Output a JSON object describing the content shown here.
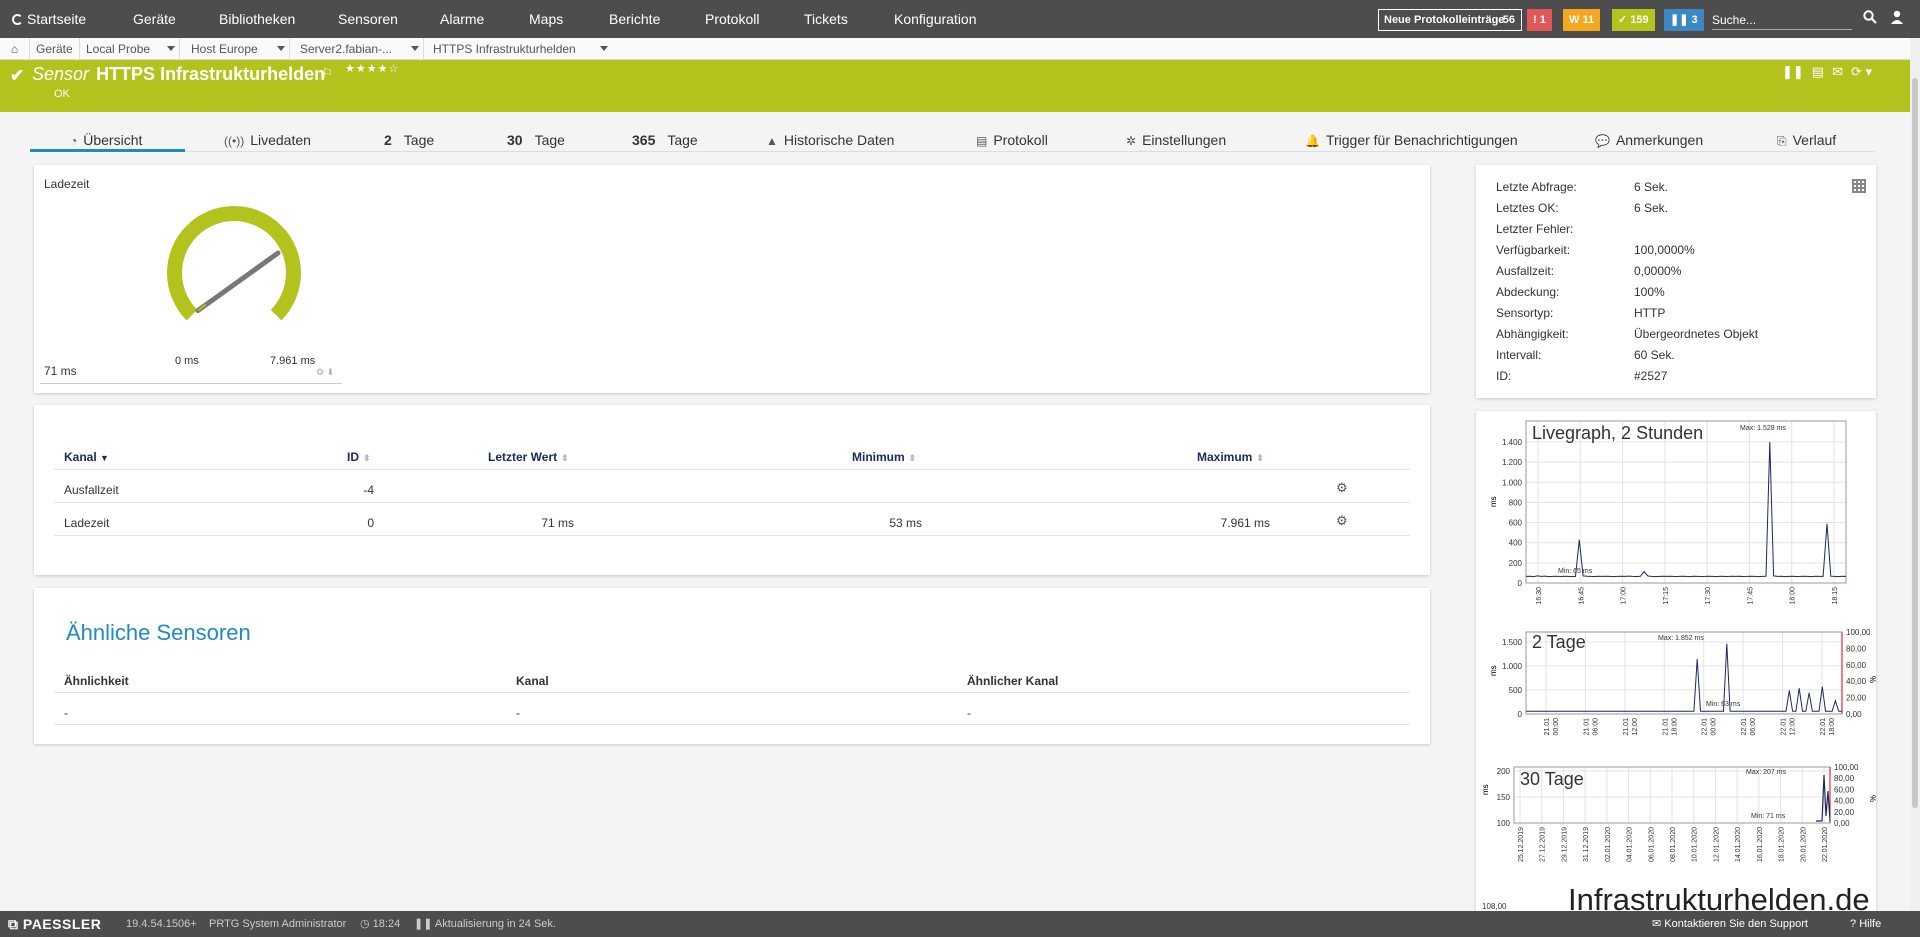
{
  "nav": {
    "home": "Startseite",
    "items": [
      "Geräte",
      "Bibliotheken",
      "Sensoren",
      "Alarme",
      "Maps",
      "Berichte",
      "Protokoll",
      "Tickets",
      "Konfiguration"
    ],
    "log_label": "Neue Protokolleinträge",
    "log_count": "56",
    "badge_red": "1",
    "badge_yellow": "11",
    "badge_green": "159",
    "badge_blue": "3",
    "search_placeholder": "Suche..."
  },
  "breadcrumb": [
    "Geräte",
    "Local Probe",
    "Host Europe",
    "Server2.fabian-...",
    "HTTPS Infrastrukturhelden"
  ],
  "sensor": {
    "prefix": "Sensor",
    "name": "HTTPS Infrastrukturhelden",
    "status": "OK",
    "stars": "★★★★☆"
  },
  "tabs": [
    {
      "icon": "◔",
      "label": "Übersicht"
    },
    {
      "icon": "((•))",
      "label": "Livedaten"
    },
    {
      "num": "2",
      "label": "Tage"
    },
    {
      "num": "30",
      "label": "Tage"
    },
    {
      "num": "365",
      "label": "Tage"
    },
    {
      "icon": "▲",
      "label": "Historische Daten"
    },
    {
      "icon": "▤",
      "label": "Protokoll"
    },
    {
      "icon": "✲",
      "label": "Einstellungen"
    },
    {
      "icon": "🔔",
      "label": "Trigger für Benachrichtigungen"
    },
    {
      "icon": "💬",
      "label": "Anmerkungen"
    },
    {
      "icon": "⎘",
      "label": "Verlauf"
    }
  ],
  "gauge": {
    "title": "Ladezeit",
    "min": "0 ms",
    "max": "7.961 ms",
    "value": "71 ms",
    "value_ratio": 0.009
  },
  "info": [
    {
      "k": "Letzte Abfrage:",
      "v": "6 Sek.",
      "bold": true
    },
    {
      "k": "Letztes OK:",
      "v": "6 Sek.",
      "bold": true
    },
    {
      "k": "Letzter Fehler:",
      "v": "",
      "bold": false
    },
    {
      "k": "Verfügbarkeit:",
      "v": "100,0000%",
      "bold": false
    },
    {
      "k": "Ausfallzeit:",
      "v": "0,0000%",
      "bold": false
    },
    {
      "k": "Abdeckung:",
      "v": "100%",
      "bold": false
    },
    {
      "k": "Sensortyp:",
      "v": "HTTP",
      "bold": true
    },
    {
      "k": "Abhängigkeit:",
      "v": "Übergeordnetes Objekt",
      "bold": true
    },
    {
      "k": "Intervall:",
      "v": "60 Sek.",
      "bold": true
    },
    {
      "k": "ID:",
      "v": "#2527",
      "bold": true
    }
  ],
  "channels": {
    "headers": [
      "Kanal",
      "ID",
      "Letzter Wert",
      "Minimum",
      "Maximum"
    ],
    "rows": [
      {
        "name": "Ausfallzeit",
        "id": "-4",
        "last": "",
        "min": "",
        "max": ""
      },
      {
        "name": "Ladezeit",
        "id": "0",
        "last": "71 ms",
        "min": "53 ms",
        "max": "7.961 ms"
      }
    ]
  },
  "similar": {
    "title": "Ähnliche Sensoren",
    "headers": [
      "Ähnlichkeit",
      "Kanal",
      "Ähnlicher Kanal"
    ],
    "row": [
      "-",
      "-",
      "-"
    ]
  },
  "graphs": {
    "live": {
      "title": "Livegraph, 2 Stunden",
      "yticks": [
        "1.400",
        "1.200",
        "1.000",
        "800",
        "600",
        "400",
        "200",
        "0"
      ],
      "xticks": [
        "16:30",
        "16:45",
        "17:00",
        "17:15",
        "17:30",
        "17:45",
        "18:00",
        "18:15"
      ],
      "max_label": "Max: 1.528 ms",
      "min_label": "Min: 65 ms",
      "ylabel": "ms",
      "values": [
        70,
        72,
        68,
        75,
        70,
        73,
        68,
        70,
        71,
        69,
        72,
        70,
        68,
        70,
        460,
        75,
        72,
        70,
        69,
        71,
        70,
        72,
        70,
        68,
        70,
        71,
        70,
        73,
        70,
        69,
        71,
        120,
        74,
        70,
        68,
        70,
        72,
        70,
        71,
        69,
        70,
        72,
        70,
        68,
        71,
        70,
        69,
        70,
        72,
        70,
        68,
        71,
        70,
        69,
        72,
        70,
        71,
        69,
        70,
        72,
        70,
        68,
        70,
        71,
        1528,
        75,
        70,
        72,
        68,
        70,
        71,
        69,
        70,
        72,
        70,
        68,
        71,
        70,
        70,
        630,
        72,
        70,
        68,
        71,
        70
      ]
    },
    "day2": {
      "title": "2 Tage",
      "yticks": [
        "1.500",
        "1.000",
        "500",
        "0"
      ],
      "rticks": [
        "100,00",
        "80,00",
        "60,00",
        "40,00",
        "20,00",
        "0,00"
      ],
      "xticks": [
        "21.01 00:00",
        "21.01 06:00",
        "21.01 12:00",
        "21.01 18:00",
        "22.01 00:00",
        "22.01 06:00",
        "22.01 12:00",
        "22.01 18:00"
      ],
      "max_label": "Max: 1.852 ms",
      "min_label": "Min: 63 ms",
      "ylabel": "ms",
      "rlabel": "%",
      "values": [
        70,
        70,
        70,
        70,
        70,
        70,
        70,
        70,
        70,
        70,
        70,
        70,
        70,
        70,
        70,
        70,
        70,
        70,
        70,
        70,
        70,
        70,
        70,
        70,
        70,
        70,
        70,
        70,
        70,
        70,
        70,
        70,
        70,
        70,
        70,
        70,
        70,
        70,
        70,
        70,
        70,
        70,
        70,
        70,
        70,
        70,
        70,
        70,
        70,
        70,
        70,
        70,
        1450,
        70,
        70,
        70,
        70,
        70,
        70,
        70,
        70,
        1852,
        70,
        70,
        70,
        70,
        70,
        70,
        70,
        70,
        70,
        70,
        70,
        70,
        70,
        70,
        70,
        70,
        70,
        70,
        620,
        70,
        70,
        680,
        70,
        70,
        560,
        70,
        70,
        70,
        720,
        70,
        70,
        70,
        350,
        70,
        70
      ]
    },
    "day30": {
      "title": "30 Tage",
      "yticks": [
        "200",
        "150",
        "100"
      ],
      "rticks": [
        "100,00",
        "80,00",
        "60,00",
        "40,00",
        "20,00",
        "0,00"
      ],
      "xticks": [
        "25.12.2019",
        "27.12.2019",
        "29.12.2019",
        "31.12.2019",
        "02.01.2020",
        "04.01.2020",
        "06.01.2020",
        "08.01.2020",
        "10.01.2020",
        "12.01.2020",
        "14.01.2020",
        "16.01.2020",
        "18.01.2020",
        "20.01.2020",
        "22.01.2020"
      ],
      "max_label": "Max: 207 ms",
      "min_label": "Min: 71 ms",
      "ylabel": "ms",
      "rlabel": "%"
    },
    "day365": {
      "ytick": "108,00"
    }
  },
  "footer": {
    "brand": "PAESSLER",
    "version": "19.4.54.1506+",
    "user": "PRTG System Administrator",
    "time": "18:24",
    "refresh": "Aktualisierung in 24 Sek.",
    "support": "Kontaktieren Sie den Support",
    "help": "Hilfe"
  },
  "watermark": "Infrastrukturhelden.de",
  "colors": {
    "accent": "#b4c21e",
    "nav": "#4d4d4d",
    "link": "#1e8bc3",
    "badge_red": "#e0585a",
    "badge_yellow": "#f4a81d",
    "badge_green": "#b4c21e",
    "badge_blue": "#3d87c4"
  }
}
